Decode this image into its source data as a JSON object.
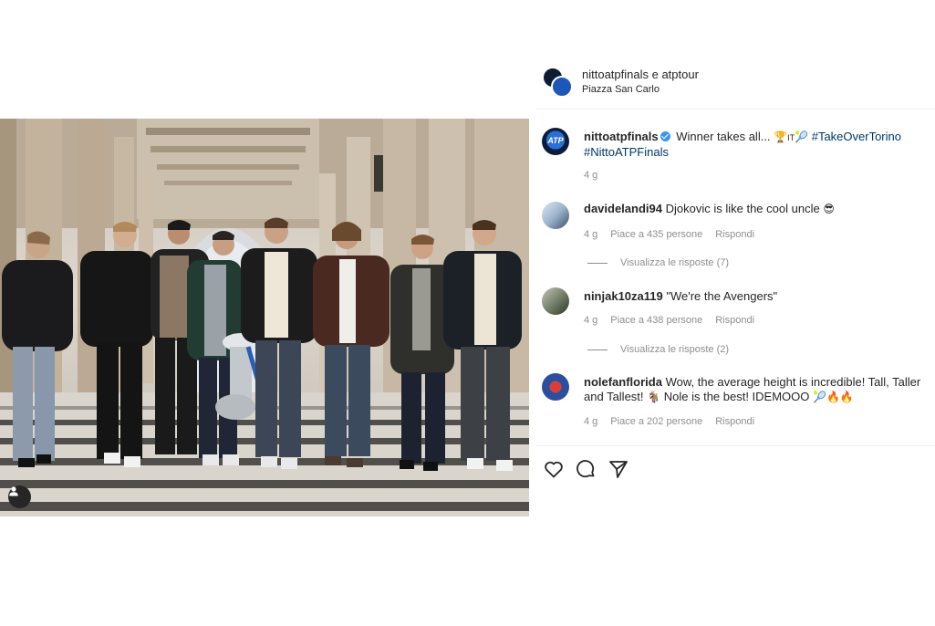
{
  "post": {
    "header": {
      "accounts": "nittoatpfinals e atptour",
      "location": "Piazza San Carlo"
    },
    "caption": {
      "username": "nittoatpfinals",
      "text": "Winner takes all...",
      "emoji": "🏆",
      "flag": "IT",
      "racket": "🎾",
      "hashtag1": "#TakeOverTorino",
      "hashtag2": "#NittoATPFinals",
      "time": "4 g",
      "avatar_text": "ATP"
    },
    "comments": [
      {
        "username": "davidelandi94",
        "text": "Djokovic is like the cool uncle",
        "emoji": "😎",
        "time": "4 g",
        "likes": "Piace a 435 persone",
        "reply": "Rispondi",
        "view_replies": "Visualizza le risposte (7)"
      },
      {
        "username": "ninjak10za119",
        "text": "\"We're the Avengers\"",
        "time": "4 g",
        "likes": "Piace a 438 persone",
        "reply": "Rispondi",
        "view_replies": "Visualizza le risposte (2)"
      },
      {
        "username": "nolefanflorida",
        "text": "Wow, the average height is incredible! Tall, Taller and Tallest!",
        "text2": "Nole is the best! IDEMOOO",
        "emoji1": "🐐",
        "emoji2": "🎾🔥🔥",
        "time": "4 g",
        "likes": "Piace a 202 persone",
        "reply": "Rispondi"
      }
    ]
  },
  "icons": {
    "like": "heart-icon",
    "comment": "comment-icon",
    "share": "paper-plane-icon",
    "tag": "user-tag-icon"
  },
  "colors": {
    "hashtag": "#00376b",
    "verified": "#3897f0",
    "muted": "#8e8e8e",
    "text": "#262626"
  }
}
